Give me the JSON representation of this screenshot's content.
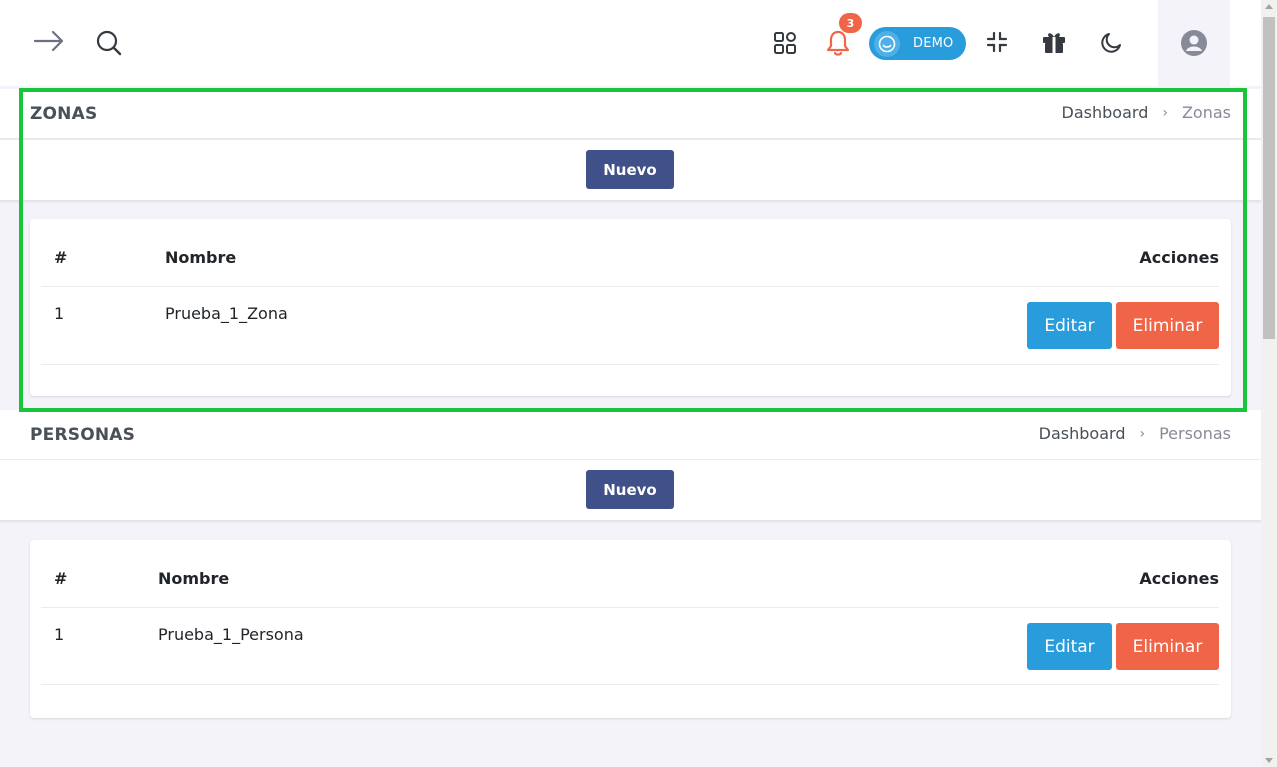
{
  "topbar": {
    "notifications_count": "3",
    "demo_label": "DEMO"
  },
  "sections": [
    {
      "title": "ZONAS",
      "breadcrumb": {
        "home": "Dashboard",
        "separator": "›",
        "current": "Zonas"
      },
      "new_button": "Nuevo",
      "table": {
        "headers": {
          "index": "#",
          "name": "Nombre",
          "actions": "Acciones"
        },
        "rows": [
          {
            "index": "1",
            "name": "Prueba_1_Zona",
            "edit": "Editar",
            "delete": "Eliminar"
          }
        ]
      }
    },
    {
      "title": "PERSONAS",
      "breadcrumb": {
        "home": "Dashboard",
        "separator": "›",
        "current": "Personas"
      },
      "new_button": "Nuevo",
      "table": {
        "headers": {
          "index": "#",
          "name": "Nombre",
          "actions": "Acciones"
        },
        "rows": [
          {
            "index": "1",
            "name": "Prueba_1_Persona",
            "edit": "Editar",
            "delete": "Eliminar"
          }
        ]
      }
    }
  ],
  "colors": {
    "primary": "#405189",
    "info": "#299cdb",
    "danger": "#f06548",
    "highlight": "#19c639"
  },
  "icons": [
    "arrow-right-icon",
    "search-icon",
    "apps-grid-icon",
    "bell-icon",
    "smile-icon",
    "fullscreen-exit-icon",
    "gift-icon",
    "moon-icon",
    "user-circle-icon"
  ]
}
